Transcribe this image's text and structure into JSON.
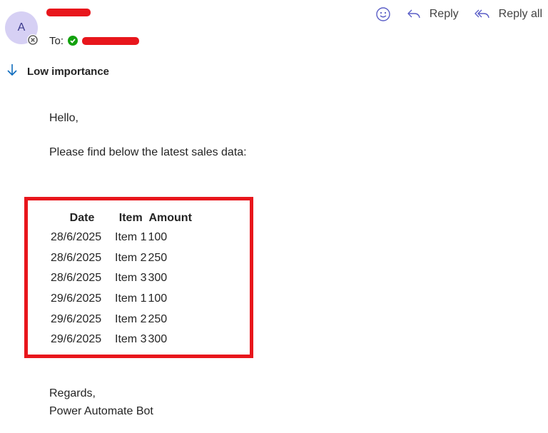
{
  "sender": {
    "avatar_initial": "A",
    "to_label": "To:"
  },
  "actions": {
    "emoji_icon": "smiley-icon",
    "reply_label": "Reply",
    "reply_all_label": "Reply all"
  },
  "importance": {
    "label": "Low importance",
    "icon": "arrow-down-icon"
  },
  "message": {
    "greeting": "Hello,",
    "intro": "Please find below the latest sales data:",
    "regards": "Regards,",
    "signoff": "Power Automate Bot"
  },
  "table": {
    "headers": [
      "Date",
      "Item",
      "Amount"
    ],
    "rows": [
      [
        "28/6/2025",
        "Item 1",
        "100"
      ],
      [
        "28/6/2025",
        "Item 2",
        "250"
      ],
      [
        "28/6/2025",
        "Item 3",
        "300"
      ],
      [
        "29/6/2025",
        "Item 1",
        "100"
      ],
      [
        "29/6/2025",
        "Item 2",
        "250"
      ],
      [
        "29/6/2025",
        "Item 3",
        "300"
      ]
    ]
  },
  "colors": {
    "avatar_bg": "#d6d0f4",
    "redaction": "#e8161c",
    "accent_icon": "#5b5fc7",
    "importance_icon": "#0f6cbd",
    "presence_ok": "#13a10e"
  }
}
